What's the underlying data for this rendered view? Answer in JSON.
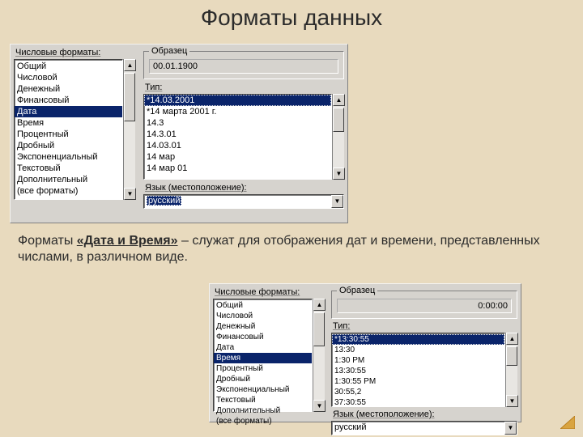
{
  "title": "Форматы данных",
  "paragraph": {
    "prefix": "Форматы ",
    "bold": "«Дата и Время»",
    "rest": " – служат для отображения дат и времени, представленных числами, в различном виде."
  },
  "labels": {
    "number_formats": "Числовые форматы:",
    "sample": "Образец",
    "type": "Тип:",
    "locale": "Язык (местоположение):"
  },
  "dialog1": {
    "formats": [
      "Общий",
      "Числовой",
      "Денежный",
      "Финансовый",
      "Дата",
      "Время",
      "Процентный",
      "Дробный",
      "Экспоненциальный",
      "Текстовый",
      "Дополнительный",
      "(все форматы)"
    ],
    "formats_selected_index": 4,
    "sample_value": "00.01.1900",
    "types": [
      "*14.03.2001",
      "*14 марта 2001 г.",
      "14.3",
      "14.3.01",
      "14.03.01",
      "14 мар",
      "14 мар 01"
    ],
    "types_selected_index": 0,
    "locale_value": "русский"
  },
  "dialog2": {
    "formats": [
      "Общий",
      "Числовой",
      "Денежный",
      "Финансовый",
      "Дата",
      "Время",
      "Процентный",
      "Дробный",
      "Экспоненциальный",
      "Текстовый",
      "Дополнительный",
      "(все форматы)"
    ],
    "formats_selected_index": 5,
    "sample_value": "0:00:00",
    "types": [
      "*13:30:55",
      "13:30",
      "1:30 PM",
      "13:30:55",
      "1:30:55 PM",
      "30:55,2",
      "37:30:55"
    ],
    "types_selected_index": 0,
    "locale_value": "русский"
  }
}
